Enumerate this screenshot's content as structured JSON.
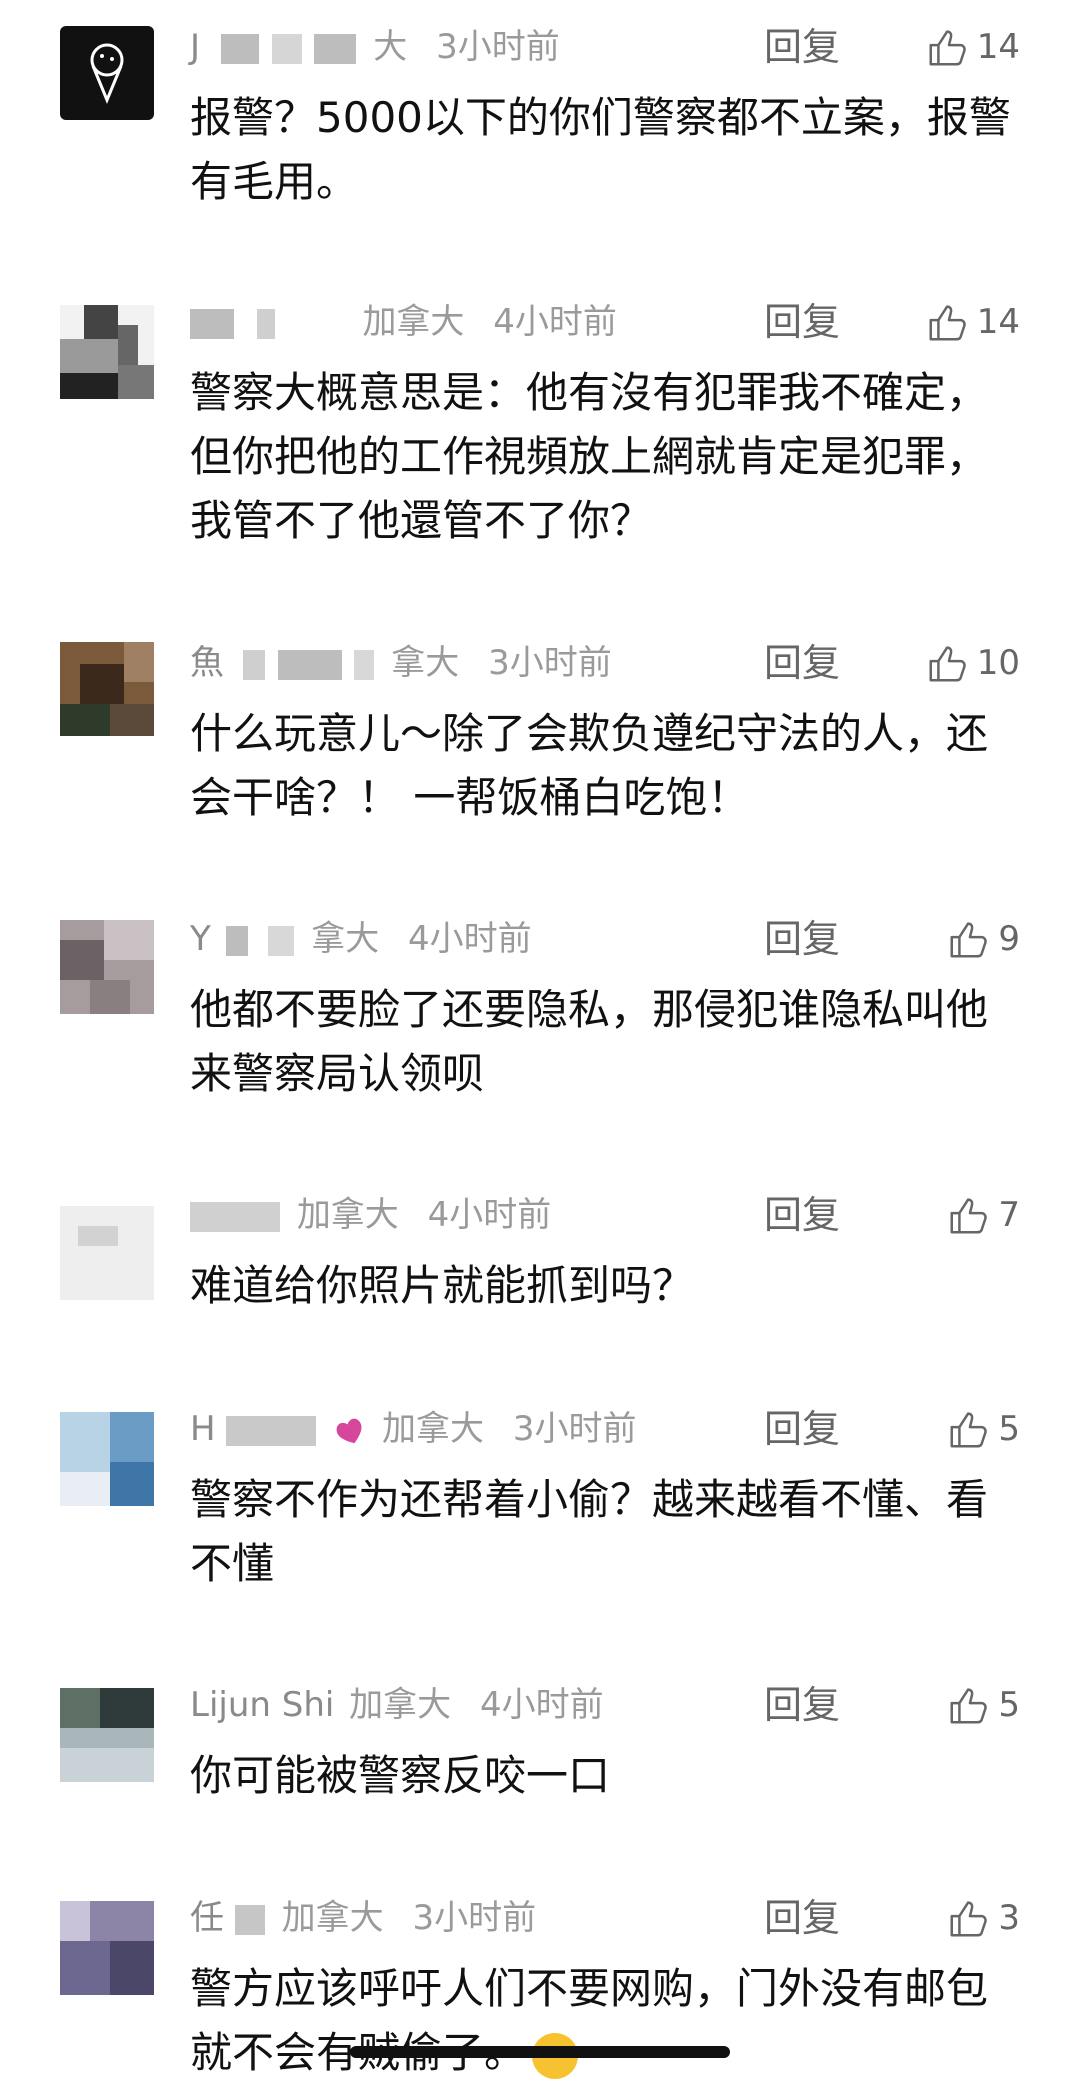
{
  "comments": [
    {
      "name": "J",
      "location": "大",
      "time": "3小时前",
      "reply": "回复",
      "likes": "14",
      "text": "报警？5000以下的你们警察都不立案，报警有毛用。",
      "avatar_icon": "ice-cream-icon",
      "avatar_colors": [
        "#111111"
      ]
    },
    {
      "name": "",
      "location": "加拿大",
      "time": "4小时前",
      "reply": "回复",
      "likes": "14",
      "text": "警察大概意思是：他有沒有犯罪我不確定，但你把他的工作視頻放上網就肯定是犯罪，我管不了他還管不了你？",
      "avatar_colors": [
        "#444444",
        "#9a9a9a",
        "#222222",
        "#777777"
      ]
    },
    {
      "name": "魚",
      "location": "拿大",
      "time": "3小时前",
      "reply": "回复",
      "likes": "10",
      "text": "什么玩意儿～除了会欺负遵纪守法的人，还会干啥？！ 一帮饭桶白吃饱！",
      "avatar_colors": [
        "#7a5a3a",
        "#3b2a1c",
        "#a08064",
        "#2e3a2a"
      ]
    },
    {
      "name": "Y",
      "location": "拿大",
      "time": "4小时前",
      "reply": "回复",
      "likes": "9",
      "text": "他都不要脸了还要隐私，那侵犯谁隐私叫他来警察局认领呗",
      "avatar_colors": [
        "#8a7f80",
        "#c8c0c2",
        "#6a6264",
        "#a69c9e"
      ]
    },
    {
      "name": "",
      "location": "加拿大",
      "time": "4小时前",
      "reply": "回复",
      "likes": "7",
      "text": "难道给你照片就能抓到吗？",
      "avatar_colors": [
        "#eeeeee",
        "#d2d2d2"
      ]
    },
    {
      "name": "H",
      "location": "加拿大",
      "time": "3小时前",
      "reply": "回复",
      "likes": "5",
      "text": "警察不作为还帮着小偷？越来越看不懂、看不懂",
      "avatar_colors": [
        "#6a9cc6",
        "#b9d3e6",
        "#3f76a8",
        "#e8eef3"
      ]
    },
    {
      "name": "Lijun Shi",
      "location": "加拿大",
      "time": "4小时前",
      "reply": "回复",
      "likes": "5",
      "text": "你可能被警察反咬一口",
      "avatar_colors": [
        "#5e6f66",
        "#a9b6ba",
        "#2e3b3a",
        "#c9d2d6"
      ]
    },
    {
      "name": "任",
      "location": "加拿大",
      "time": "3小时前",
      "reply": "回复",
      "likes": "3",
      "text": "警方应该呼吁人们不要网购，门外没有邮包就不会有贼偷了。",
      "avatar_colors": [
        "#8c85a8",
        "#4a4768",
        "#c8c3d8",
        "#6d6890"
      ]
    }
  ]
}
